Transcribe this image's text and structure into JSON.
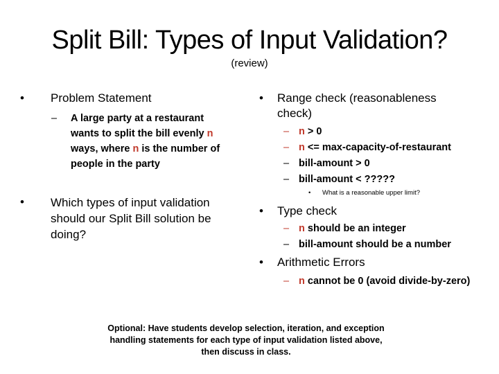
{
  "slide": {
    "title": "Split Bill: Types of Input Validation?",
    "subtitle": "(review)",
    "accent_color": "#c0392b",
    "left": {
      "bullets": [
        {
          "text": "Problem Statement",
          "subitem": {
            "line1": "A large party at a restaurant",
            "line2_pre": "wants to split the bill evenly ",
            "var": "n",
            "line3_pre": "ways, where ",
            "line3_post": " is the number of",
            "line4": "people in the party"
          }
        },
        {
          "lines": [
            "Which types of input validation",
            "should our Split Bill solution be",
            "doing?"
          ]
        }
      ]
    },
    "right": {
      "range_check": {
        "lines": [
          "Range check (reasonableness",
          "check)"
        ],
        "items": [
          {
            "var": "n",
            "text": " > 0"
          },
          {
            "var": "n",
            "text": " <= max-capacity-of-restaurant"
          },
          {
            "var": "",
            "text": "bill-amount > 0"
          },
          {
            "var": "",
            "text": "bill-amount < ?????"
          }
        ],
        "note": "What is a reasonable upper limit?"
      },
      "type_check": {
        "label": "Type check",
        "items": [
          {
            "var": "n",
            "text": " should be an integer"
          },
          {
            "var": "",
            "text": "bill-amount should be a number"
          }
        ]
      },
      "arithmetic": {
        "label": "Arithmetic Errors",
        "items": [
          {
            "var": "n",
            "text": " cannot be 0 (avoid divide-by-zero)"
          }
        ]
      }
    },
    "footer_note": {
      "lines": [
        "Optional: Have students develop selection, iteration, and exception",
        "handling statements for each type of input validation listed above,",
        "then discuss in class."
      ]
    },
    "glyphs": {
      "bullet": "•",
      "dash": "–"
    }
  }
}
